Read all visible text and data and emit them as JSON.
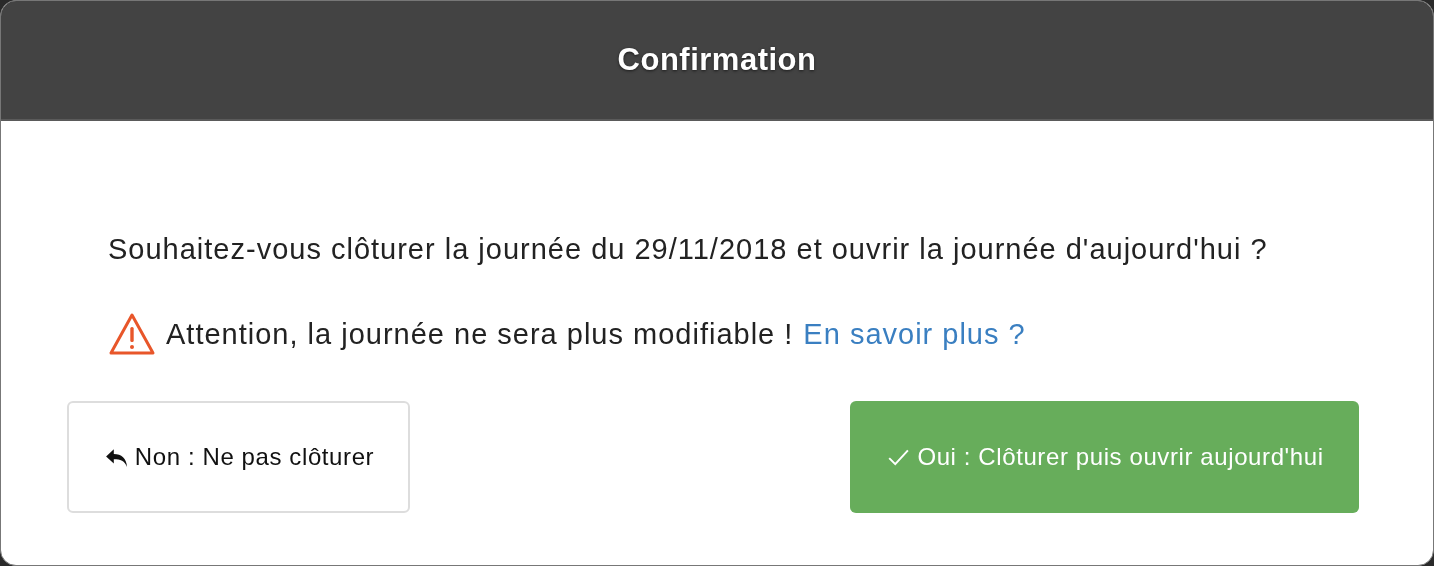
{
  "dialog": {
    "title": "Confirmation",
    "message": "Souhaitez-vous clôturer la journée du 29/11/2018 et ouvrir la journée d'aujourd'hui ?",
    "warning": {
      "text": "Attention, la journée ne sera plus modifiable !",
      "link": "En savoir plus ?"
    },
    "buttons": [
      {
        "kind": "cancel",
        "label": "Non : Ne pas clôturer"
      },
      {
        "kind": "confirm",
        "label": "Oui : Clôturer puis ouvrir aujourd'hui"
      }
    ]
  }
}
